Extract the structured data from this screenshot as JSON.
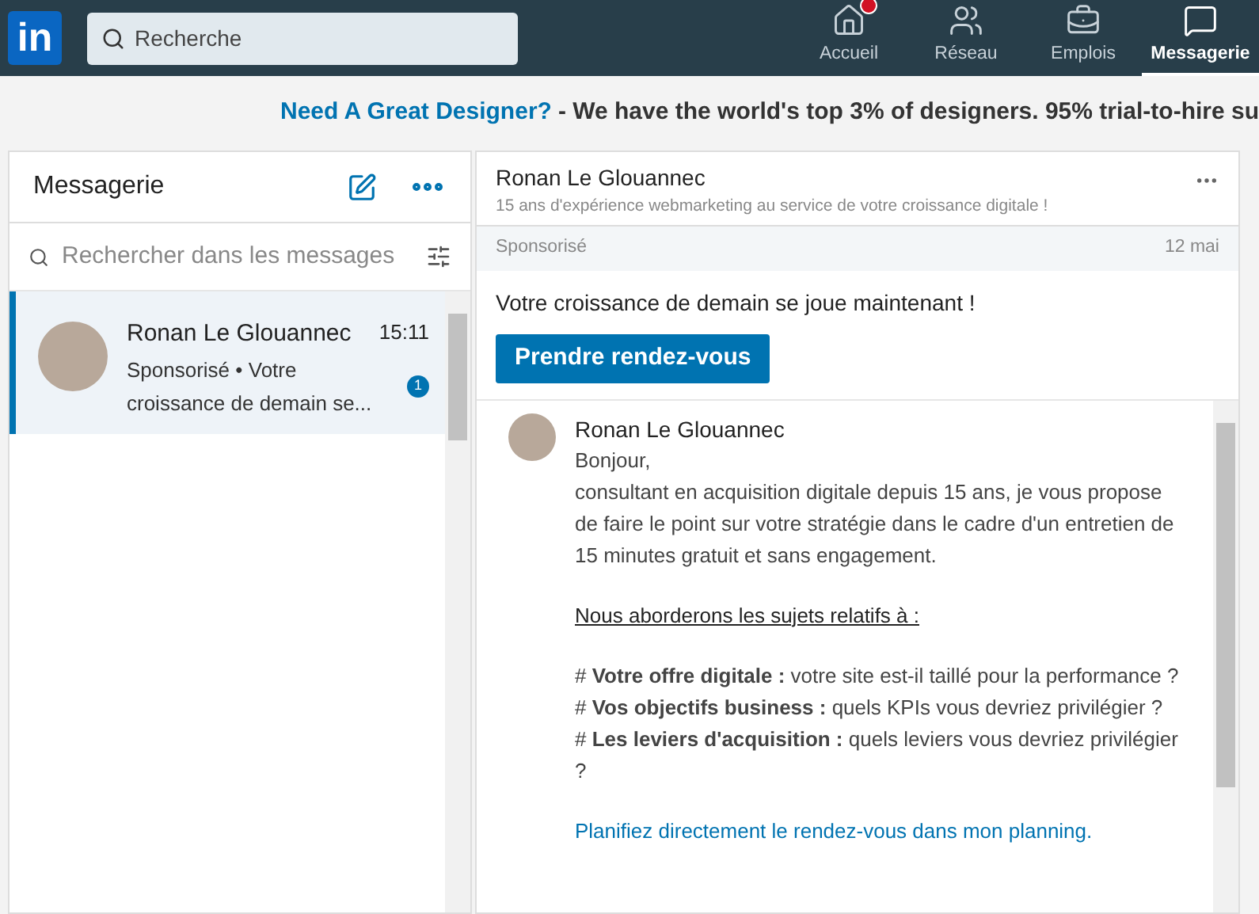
{
  "header": {
    "logo": "in",
    "search": {
      "placeholder": "Recherche"
    },
    "nav": [
      {
        "label": "Accueil",
        "selected": false,
        "notification": true
      },
      {
        "label": "Réseau",
        "selected": false,
        "notification": false
      },
      {
        "label": "Emplois",
        "selected": false,
        "notification": false
      },
      {
        "label": "Messagerie",
        "selected": true,
        "notification": false
      }
    ]
  },
  "banner": {
    "link": "Need A Great Designer?",
    "text": "- We have the world's top 3% of designers. 95% trial-to-hire su"
  },
  "sidebar": {
    "title": "Messagerie",
    "search": {
      "placeholder": "Rechercher dans les messages"
    },
    "conversations": [
      {
        "name": "Ronan Le Glouannec",
        "time": "15:11",
        "preview_label": "Sponsorisé",
        "preview_separator": "•",
        "preview": "Votre croissance de demain se...",
        "unread": "1",
        "selected": true
      }
    ]
  },
  "conversation": {
    "name": "Ronan Le Glouannec",
    "headline": "15 ans d'expérience webmarketing au service de votre croissance digitale !",
    "sponsored": "Sponsorisé",
    "date": "12 mai",
    "subject": "Votre croissance de demain se joue maintenant !",
    "cta": "Prendre rendez-vous",
    "message": {
      "sender": "Ronan Le Glouannec",
      "paragraphs": [
        {
          "kind": "text",
          "text": "Bonjour,"
        },
        {
          "kind": "text",
          "text": "consultant en acquisition digitale depuis 15 ans, je vous propose de faire le point sur votre stratégie dans le cadre d'un entretien de 15 minutes gratuit et sans engagement."
        },
        {
          "kind": "heading",
          "text": "Nous aborderons les sujets relatifs à :"
        },
        {
          "kind": "text",
          "text": "# **Votre offre digitale :** votre site est-il taillé pour la performance ?"
        },
        {
          "kind": "text",
          "text": "# **Vos objectifs business :** quels KPIs vous devriez privilégier ?"
        },
        {
          "kind": "text",
          "text": "# **Les leviers d'acquisition :** quels leviers vous devriez privilégier ?"
        },
        {
          "kind": "link",
          "text": "Planifiez directement le rendez-vous dans mon planning."
        }
      ]
    }
  }
}
